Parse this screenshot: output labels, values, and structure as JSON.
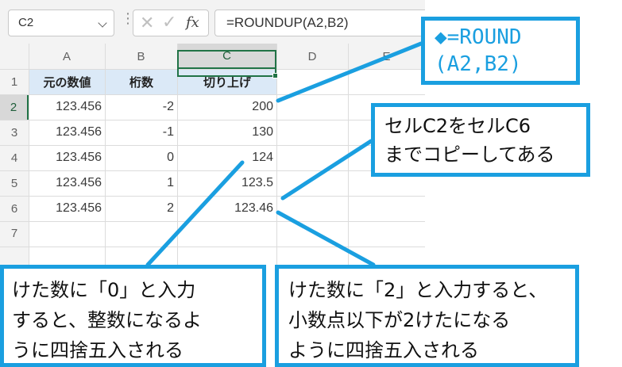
{
  "name_box": {
    "value": "C2"
  },
  "formula_bar": {
    "separator": "⋮",
    "cancel_glyph": "✕",
    "enter_glyph": "✓",
    "fx_label": "fx",
    "formula": "=ROUNDUP(A2,B2)"
  },
  "columns": [
    "A",
    "B",
    "C",
    "D",
    "E"
  ],
  "rows": [
    "1",
    "2",
    "3",
    "4",
    "5",
    "6",
    "7"
  ],
  "header_row": {
    "a": "元の数値",
    "b": "桁数",
    "c": "切り上げ"
  },
  "data_rows": [
    {
      "a": "123.456",
      "b": "-2",
      "c": "200"
    },
    {
      "a": "123.456",
      "b": "-1",
      "c": "130"
    },
    {
      "a": "123.456",
      "b": "0",
      "c": "124"
    },
    {
      "a": "123.456",
      "b": "1",
      "c": "123.5"
    },
    {
      "a": "123.456",
      "b": "2",
      "c": "123.46"
    }
  ],
  "callouts": {
    "formula": {
      "line1": "◆=ROUND",
      "line2": "(A2,B2)"
    },
    "copy": {
      "line1": "セルC2をセルC6",
      "line2": "までコピーしてある"
    },
    "integer": {
      "line1": "けた数に「0」と入力",
      "line2": "すると、整数になるよ",
      "line3": "うに四捨五入される"
    },
    "decimal": {
      "line1": "けた数に「2」と入力すると、",
      "line2": "小数点以下が2けたになる",
      "line3": "ように四捨五入される"
    }
  },
  "colors": {
    "accent_blue": "#1a9fe0",
    "excel_green": "#217346",
    "header_fill": "#dbe9f7"
  }
}
